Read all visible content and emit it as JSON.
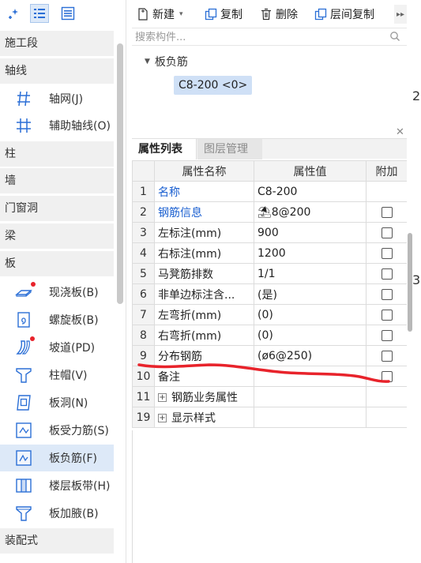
{
  "left_nav": {
    "categories": [
      "施工段",
      "轴线",
      "柱",
      "墙",
      "门窗洞",
      "梁",
      "板",
      "装配式"
    ],
    "axis_items": [
      "轴网(J)",
      "辅助轴线(O)"
    ],
    "slab_items": [
      "现浇板(B)",
      "螺旋板(B)",
      "坡道(PD)",
      "柱帽(V)",
      "板洞(N)",
      "板受力筋(S)",
      "板负筋(F)",
      "楼层板带(H)",
      "板加腋(B)"
    ]
  },
  "toolbar": {
    "new_label": "新建",
    "copy_label": "复制",
    "delete_label": "删除",
    "floor_copy_label": "层间复制"
  },
  "search": {
    "placeholder": "搜索构件..."
  },
  "tree": {
    "root_label": "板负筋",
    "item_label": "C8-200 <0>"
  },
  "tabs": {
    "properties": "属性列表",
    "layers": "图层管理"
  },
  "table": {
    "headers": [
      "属性名称",
      "属性值",
      "附加"
    ],
    "rows": [
      {
        "num": "1",
        "name": "名称",
        "value": "C8-200"
      },
      {
        "num": "2",
        "name": "钢筋信息",
        "value": "⛱8@200"
      },
      {
        "num": "3",
        "name": "左标注(mm)",
        "value": "900"
      },
      {
        "num": "4",
        "name": "右标注(mm)",
        "value": "1200"
      },
      {
        "num": "5",
        "name": "马凳筋排数",
        "value": "1/1"
      },
      {
        "num": "6",
        "name": "非单边标注含...",
        "value": "(是)"
      },
      {
        "num": "7",
        "name": "左弯折(mm)",
        "value": "(0)"
      },
      {
        "num": "8",
        "name": "右弯折(mm)",
        "value": "(0)"
      },
      {
        "num": "9",
        "name": "分布钢筋",
        "value": "(ø6@250)"
      },
      {
        "num": "10",
        "name": "备注",
        "value": ""
      },
      {
        "num": "11",
        "name": "钢筋业务属性",
        "value": ""
      },
      {
        "num": "19",
        "name": "显示样式",
        "value": ""
      }
    ]
  },
  "edge": {
    "char_top": "2",
    "char_mid": "3"
  },
  "colors": {
    "accent_blue": "#1a5fd0",
    "selection": "#dde9f8",
    "annotation_red": "#e8232b"
  }
}
